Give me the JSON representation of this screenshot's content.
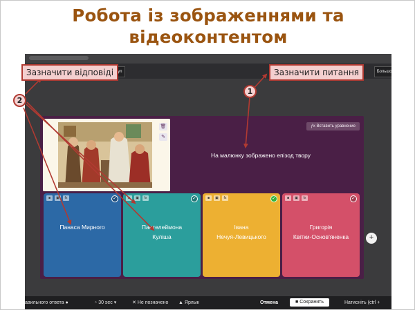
{
  "slide": {
    "title_line1": "Робота із зображеннями та",
    "title_line2": "відеоконтентом"
  },
  "annotations": {
    "answers_label": "Зазначити відповіді",
    "question_label": "Зазначити питання",
    "badge_question": "1",
    "badge_answers": "2",
    "annotation_color": "#b13a32"
  },
  "app": {
    "toolbar": {
      "formula_button": "мул",
      "more_button": "Большой"
    },
    "editor": {
      "insert_equation_button": "Вставить уравнение",
      "question_text": "На малюнку зображено епізод твору",
      "image_tools": [
        "trash-icon",
        "pencil-icon"
      ],
      "background_color": "#4a1f46"
    },
    "answers": [
      {
        "line1": "Панаса Мирного",
        "line2": "",
        "color": "#2c69a6",
        "correct": false
      },
      {
        "line1": "Пантелеймона",
        "line2": "Куліша",
        "color": "#2b9e9c",
        "correct": false
      },
      {
        "line1": "Івана",
        "line2": "Нечуя-Левицького",
        "color": "#edb032",
        "correct": true
      },
      {
        "line1": "Григорія",
        "line2": "Квітки-Основ'яненка",
        "color": "#d45069",
        "correct": false
      }
    ],
    "add_answer": "+",
    "bottom_bar": {
      "answer_mode": "авильного ответа",
      "timer": "30 sec",
      "not_assigned": "Не позначено",
      "tag": "Ярлык",
      "cancel": "Отмена",
      "save": "Сохранить",
      "hint": "Натисніть (ctrl +"
    }
  }
}
